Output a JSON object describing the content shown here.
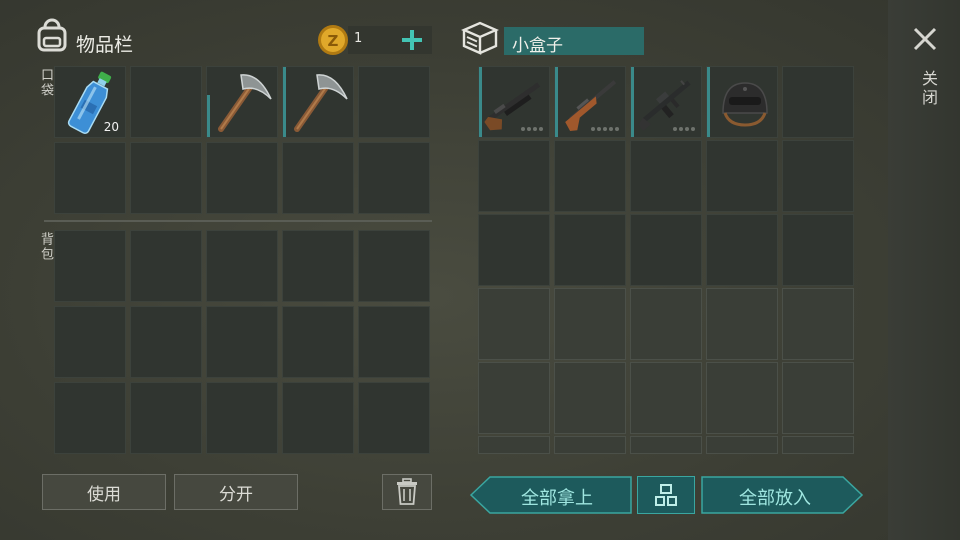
{
  "inventory": {
    "title": "物品栏",
    "coins_value": "1",
    "pocket_label": "口袋",
    "backpack_label": "背包",
    "bottle_qty": "20"
  },
  "container": {
    "title": "小盒子"
  },
  "buttons": {
    "use": "使用",
    "split": "分开",
    "take_all": "全部拿上",
    "put_all": "全部放入"
  },
  "close": {
    "label": "关闭"
  },
  "colors": {
    "rarity_teal": "#3a8a8a",
    "button_teal": "#1d5a5c",
    "coin_gold": "#e0a82a",
    "plus_teal": "#43c4b4"
  }
}
